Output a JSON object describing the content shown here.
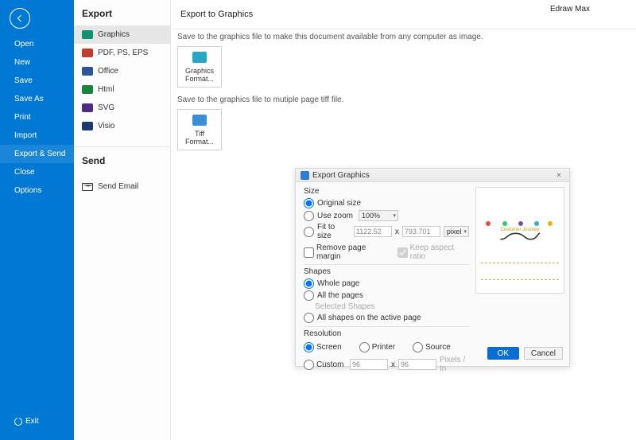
{
  "app_title": "Edraw Max",
  "sidebar": {
    "items": [
      {
        "label": "Open"
      },
      {
        "label": "New"
      },
      {
        "label": "Save"
      },
      {
        "label": "Save As"
      },
      {
        "label": "Print"
      },
      {
        "label": "Import"
      },
      {
        "label": "Export & Send"
      },
      {
        "label": "Close"
      },
      {
        "label": "Options"
      }
    ],
    "active_index": 6,
    "exit_label": "Exit"
  },
  "export_panel": {
    "header": "Export",
    "formats": [
      {
        "label": "Graphics"
      },
      {
        "label": "PDF, PS, EPS"
      },
      {
        "label": "Office"
      },
      {
        "label": "Html"
      },
      {
        "label": "SVG"
      },
      {
        "label": "Visio"
      }
    ],
    "selected_format_index": 0,
    "send_header": "Send",
    "send_item": "Send Email"
  },
  "main": {
    "title": "Export to Graphics",
    "desc1": "Save to the graphics file to make this document available from any computer as image.",
    "thumb1": "Graphics Format...",
    "desc2": "Save to the graphics file to mutiple page tiff file.",
    "thumb2": "Tiff Format..."
  },
  "dialog": {
    "title": "Export Graphics",
    "size": {
      "section": "Size",
      "opt_original": "Original size",
      "opt_zoom": "Use zoom",
      "zoom_value": "100%",
      "opt_fit": "Fit to size",
      "w": "1122.52",
      "x_label": "x",
      "h": "793.701",
      "unit": "pixel",
      "remove_margin": "Remove page margin",
      "keep_aspect": "Keep aspect ratio",
      "selected": "original"
    },
    "shapes": {
      "section": "Shapes",
      "opt_whole": "Whole page",
      "opt_all": "All the pages",
      "opt_selected": "Selected Shapes",
      "opt_active": "All shapes on the active page",
      "selected": "whole"
    },
    "resolution": {
      "section": "Resolution",
      "opt_screen": "Screen",
      "opt_printer": "Printer",
      "opt_source": "Source",
      "opt_custom": "Custom",
      "valx": "96",
      "x_label": "x",
      "valy": "96",
      "unit": "Pixels / In",
      "selected": "screen"
    },
    "preview_title": "Customer Journey",
    "ok": "OK",
    "cancel": "Cancel"
  }
}
